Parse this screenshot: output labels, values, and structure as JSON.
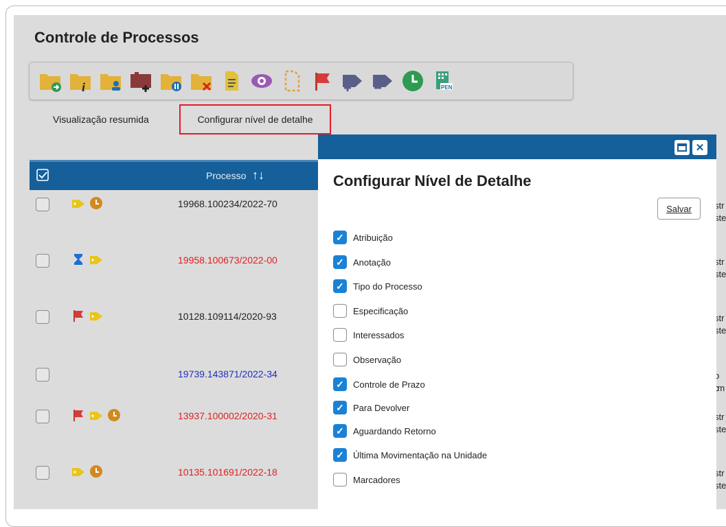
{
  "page": {
    "title": "Controle de Processos"
  },
  "toolbar": {
    "buttons": [
      "folder-arrow-icon",
      "folder-info-icon",
      "folder-user-icon",
      "folder-plus-icon",
      "folder-pause-icon",
      "folder-delete-icon",
      "document-note-icon",
      "eye-icon",
      "dashed-document-icon",
      "flag-icon",
      "tag-plus-icon",
      "tag-minus-icon",
      "clock-icon",
      "pen-icon"
    ]
  },
  "tabs": {
    "summary": "Visualização resumida",
    "detail": "Configurar nível de detalhe"
  },
  "table": {
    "column_process": "Processo",
    "sort_glyph": "↑↓",
    "rows": [
      {
        "number": "19968.100234/2022-70",
        "color": "#222222",
        "icons": [
          "tag",
          "clock"
        ]
      },
      {
        "number": "19958.100673/2022-00",
        "color": "#e02020",
        "icons": [
          "hourglass",
          "tag"
        ]
      },
      {
        "number": "10128.109114/2020-93",
        "color": "#222222",
        "icons": [
          "flag",
          "tag"
        ]
      },
      {
        "number": "19739.143871/2022-34",
        "color": "#1e2fbd",
        "icons": []
      },
      {
        "number": "13937.100002/2020-31",
        "color": "#e02020",
        "icons": [
          "flag",
          "tag",
          "clock"
        ]
      },
      {
        "number": "10135.101691/2022-18",
        "color": "#e02020",
        "icons": [
          "tag",
          "clock"
        ]
      }
    ],
    "right_fragments": [
      [
        "str",
        "ste"
      ],
      [
        "str",
        "ste"
      ],
      [
        "str",
        "ste"
      ],
      [
        "o c",
        "rm"
      ],
      [
        "str",
        "ste"
      ],
      [
        "str",
        "ste"
      ]
    ]
  },
  "modal": {
    "title": "Configurar Nível de Detalhe",
    "save_label": "Salvar",
    "options": [
      {
        "label": "Atribuição",
        "checked": true
      },
      {
        "label": "Anotação",
        "checked": true
      },
      {
        "label": "Tipo do Processo",
        "checked": true
      },
      {
        "label": "Especificação",
        "checked": false
      },
      {
        "label": "Interessados",
        "checked": false
      },
      {
        "label": "Observação",
        "checked": false
      },
      {
        "label": "Controle de Prazo",
        "checked": true
      },
      {
        "label": "Para Devolver",
        "checked": true
      },
      {
        "label": "Aguardando Retorno",
        "checked": true
      },
      {
        "label": "Última Movimentação na Unidade",
        "checked": true
      },
      {
        "label": "Marcadores",
        "checked": false
      }
    ]
  }
}
